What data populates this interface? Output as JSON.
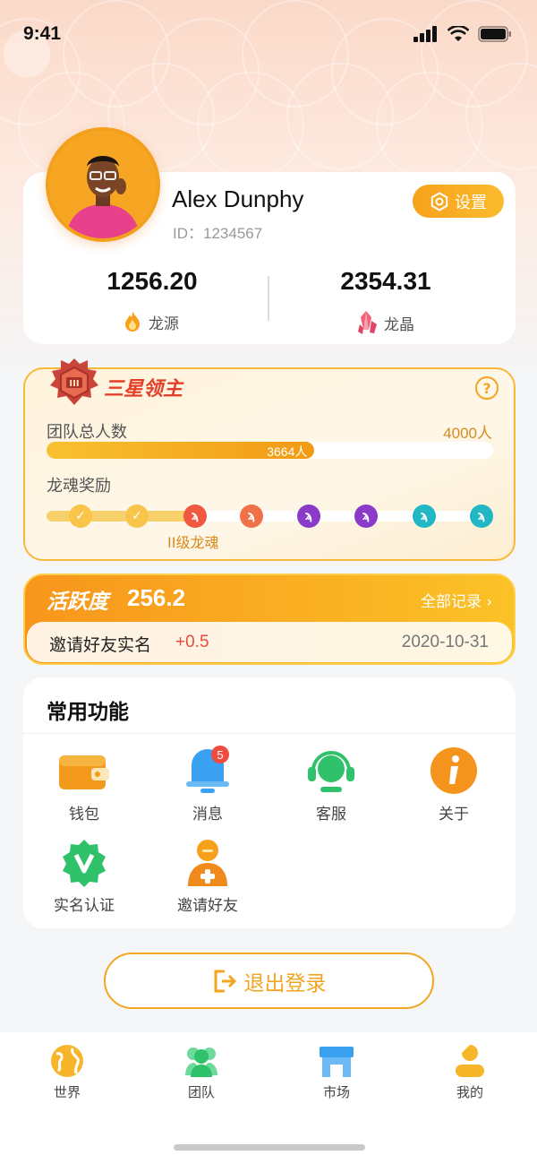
{
  "status_bar": {
    "time": "9:41"
  },
  "profile": {
    "name": "Alex Dunphy",
    "id_text": "ID：1234567",
    "settings_label": "设置",
    "stats": [
      {
        "value": "1256.20",
        "label": "龙源",
        "icon": "flame-icon"
      },
      {
        "value": "2354.31",
        "label": "龙晶",
        "icon": "crystal-icon"
      }
    ]
  },
  "rank": {
    "title": "三星领主",
    "badge_numeral": "III",
    "team_label": "团队总人数",
    "team_max": "4000人",
    "team_current": "3664人",
    "team_progress_fraction": 0.6,
    "soul_label": "龙魂奖励",
    "soul_caption": "II级龙魂",
    "soul_progress_fraction": 0.33
  },
  "activity": {
    "title": "活跃度",
    "value": "256.2",
    "all_records": "全部记录",
    "record": {
      "desc": "邀请好友实名",
      "delta": "+0.5",
      "date": "2020-10-31"
    }
  },
  "functions": {
    "title": "常用功能",
    "items": [
      {
        "label": "钱包",
        "icon": "wallet-icon"
      },
      {
        "label": "消息",
        "icon": "bell-icon",
        "badge": "5"
      },
      {
        "label": "客服",
        "icon": "headset-icon"
      },
      {
        "label": "关于",
        "icon": "info-icon"
      },
      {
        "label": "实名认证",
        "icon": "verified-icon"
      },
      {
        "label": "邀请好友",
        "icon": "add-user-icon"
      }
    ]
  },
  "logout_label": "退出登录",
  "tabs": [
    {
      "label": "世界",
      "icon": "globe-icon"
    },
    {
      "label": "团队",
      "icon": "team-icon"
    },
    {
      "label": "市场",
      "icon": "market-icon"
    },
    {
      "label": "我的",
      "icon": "me-icon"
    }
  ],
  "colors": {
    "accent": "#f3a521",
    "red": "#e84a3c",
    "green": "#2fc26a",
    "blue": "#3aa0f0"
  }
}
